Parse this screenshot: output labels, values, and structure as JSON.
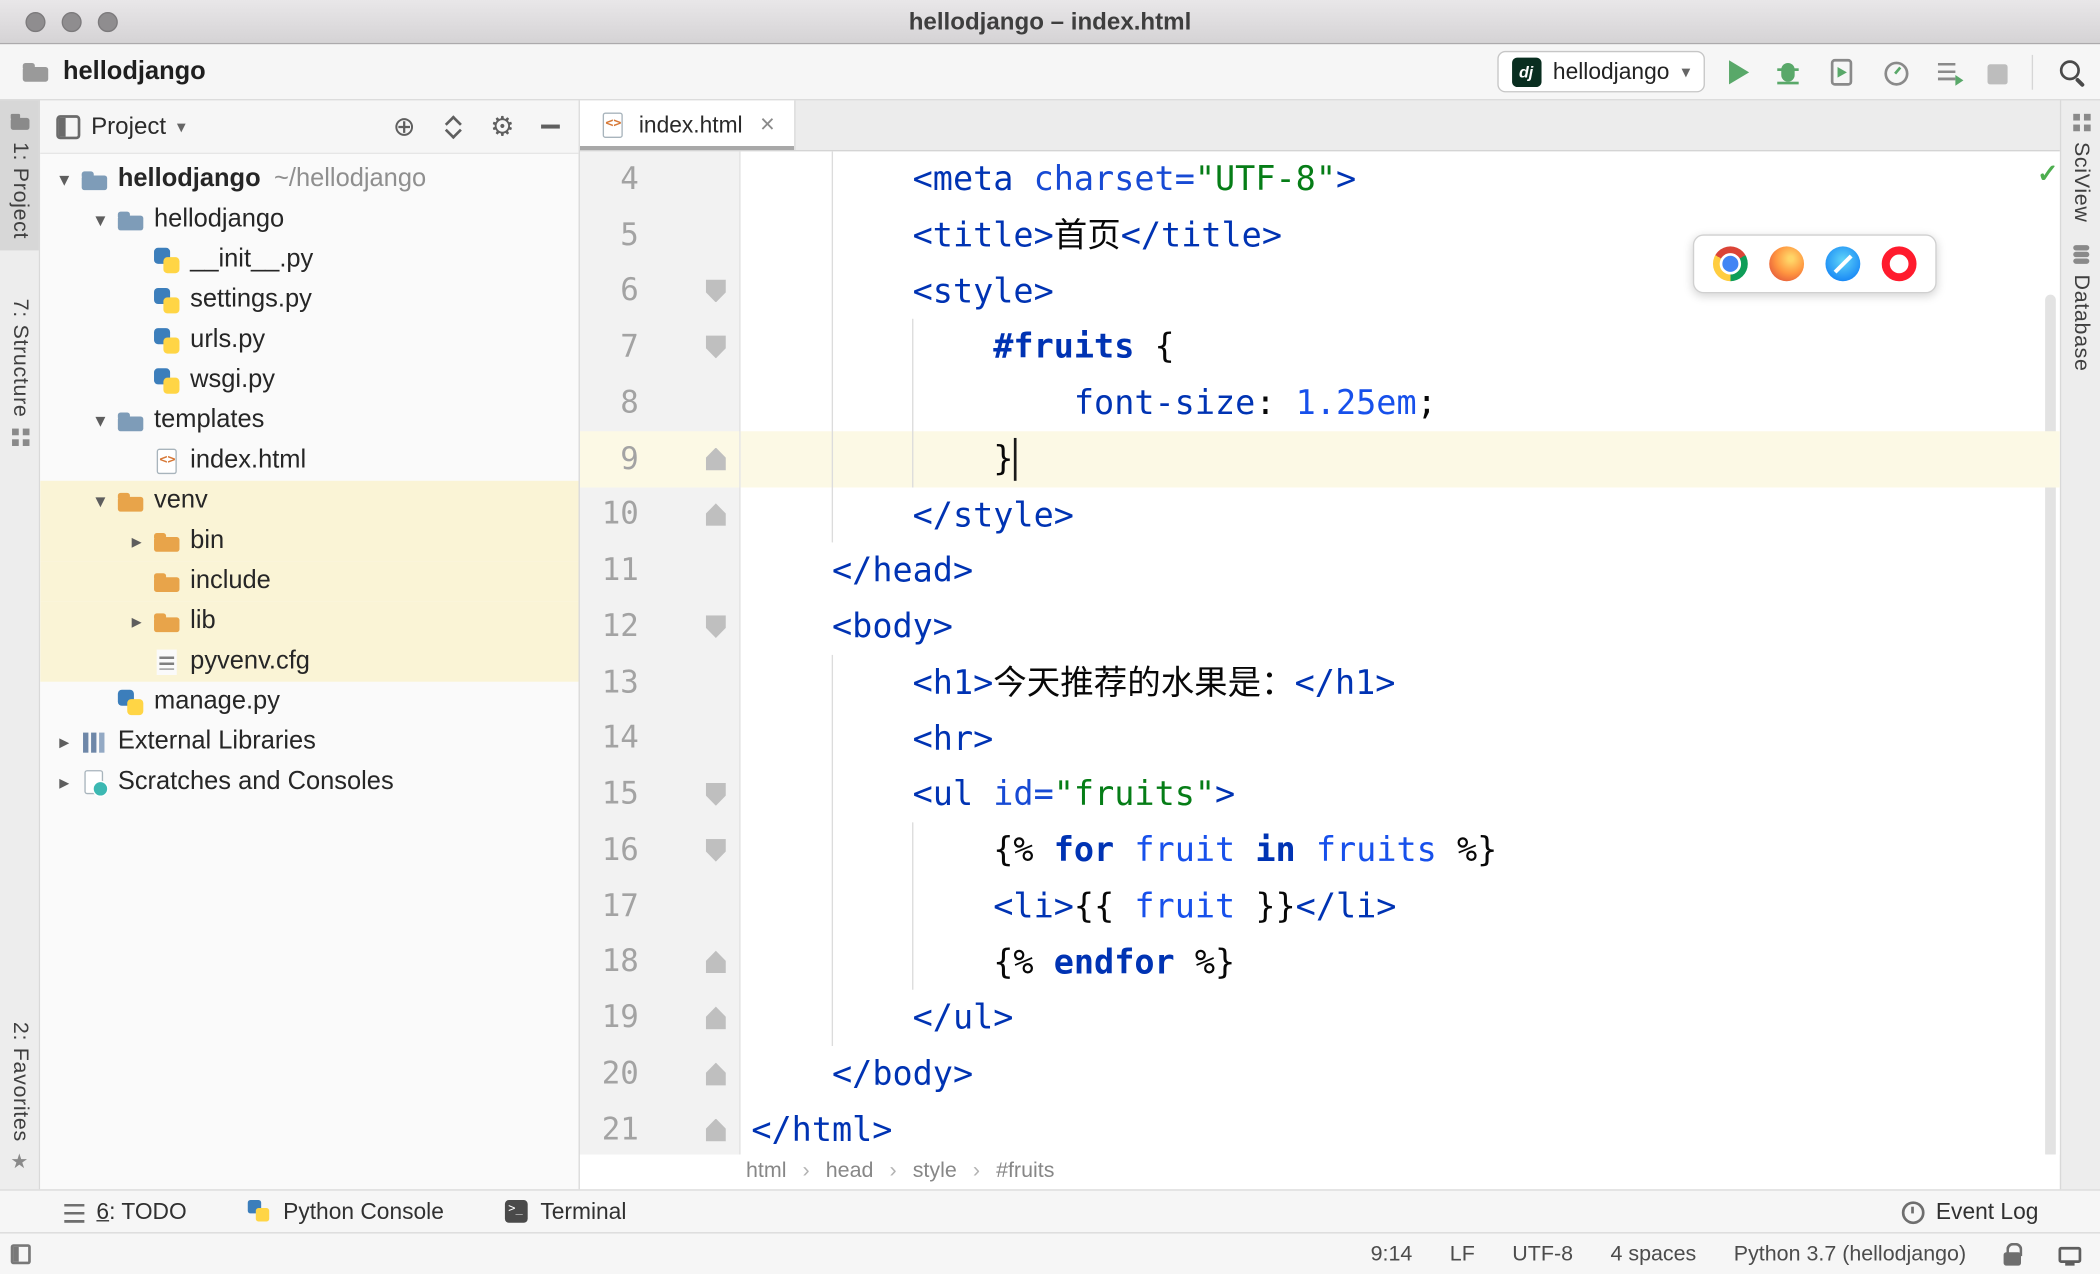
{
  "titlebar": {
    "title": "hellodjango – index.html"
  },
  "toolbar": {
    "project": "hellodjango",
    "run_config": "hellodjango",
    "dj_badge": "dj"
  },
  "docks": {
    "left": [
      "1: Project",
      "7: Structure"
    ],
    "left_bottom": [
      "2: Favorites"
    ],
    "right": [
      "SciView",
      "Database"
    ]
  },
  "project_panel": {
    "header": "Project",
    "tree": [
      {
        "label": "hellodjango",
        "suffix": "~/hellodjango",
        "level": 0,
        "icon": "folder-blue",
        "arrow": "down",
        "bold": true
      },
      {
        "label": "hellodjango",
        "level": 1,
        "icon": "folder-blue",
        "arrow": "down"
      },
      {
        "label": "__init__.py",
        "level": 2,
        "icon": "py"
      },
      {
        "label": "settings.py",
        "level": 2,
        "icon": "py"
      },
      {
        "label": "urls.py",
        "level": 2,
        "icon": "py"
      },
      {
        "label": "wsgi.py",
        "level": 2,
        "icon": "py"
      },
      {
        "label": "templates",
        "level": 1,
        "icon": "folder-blue",
        "arrow": "down"
      },
      {
        "label": "index.html",
        "level": 2,
        "icon": "html"
      },
      {
        "label": "venv",
        "level": 1,
        "icon": "folder-orange",
        "arrow": "down",
        "hl": true
      },
      {
        "label": "bin",
        "level": 2,
        "icon": "folder-orange",
        "arrow": "right",
        "hl": true
      },
      {
        "label": "include",
        "level": 2,
        "icon": "folder-orange",
        "hl": true
      },
      {
        "label": "lib",
        "level": 2,
        "icon": "folder-orange",
        "arrow": "right",
        "hl": true
      },
      {
        "label": "pyvenv.cfg",
        "level": 2,
        "icon": "cfg",
        "hl": true
      },
      {
        "label": "manage.py",
        "level": 1,
        "icon": "py"
      },
      {
        "label": "External Libraries",
        "level": 0,
        "icon": "lib",
        "arrow": "right"
      },
      {
        "label": "Scratches and Consoles",
        "level": 0,
        "icon": "scratch",
        "arrow": "right"
      }
    ]
  },
  "editor": {
    "tab": "index.html",
    "active_line": 9,
    "caret": {
      "line": 9,
      "col": 13
    },
    "breadcrumbs": [
      "html",
      "head",
      "style",
      "#fruits"
    ],
    "palette": {
      "tag": "#0033B3",
      "attr": "#174AD4",
      "str": "#067D17",
      "num": "#1750EB",
      "kw": "#0033B3",
      "var": "#1750EB",
      "plain": "#080808",
      "sel": "#0033B3",
      "prop": "#0033B3",
      "brace": "#080808"
    },
    "highlight_colors": {
      "active_line": "#FCF9E5",
      "tree_scope": "#FAF4D6"
    },
    "indent_guides": [
      {
        "col": 4,
        "from": 4,
        "to": 10
      },
      {
        "col": 8,
        "from": 7,
        "to": 9
      },
      {
        "col": 4,
        "from": 13,
        "to": 19
      },
      {
        "col": 8,
        "from": 16,
        "to": 18
      }
    ],
    "lines": [
      {
        "num": 4,
        "indent": 8,
        "tokens": [
          {
            "t": "<meta ",
            "c": "tag"
          },
          {
            "t": "charset",
            "c": "attr"
          },
          {
            "t": "=",
            "c": "attr"
          },
          {
            "t": "\"UTF-8\"",
            "c": "str"
          },
          {
            "t": ">",
            "c": "tag"
          }
        ]
      },
      {
        "num": 5,
        "indent": 8,
        "tokens": [
          {
            "t": "<title>",
            "c": "tag"
          },
          {
            "t": "首页",
            "c": "plain"
          },
          {
            "t": "</title>",
            "c": "tag"
          }
        ]
      },
      {
        "num": 6,
        "indent": 8,
        "fold": "start",
        "tokens": [
          {
            "t": "<style>",
            "c": "tag"
          }
        ]
      },
      {
        "num": 7,
        "indent": 12,
        "fold": "start",
        "tokens": [
          {
            "t": "#fruits",
            "c": "sel"
          },
          {
            "t": " {",
            "c": "plain"
          }
        ]
      },
      {
        "num": 8,
        "indent": 16,
        "tokens": [
          {
            "t": "font-size",
            "c": "prop"
          },
          {
            "t": ": ",
            "c": "plain"
          },
          {
            "t": "1.25em",
            "c": "num"
          },
          {
            "t": ";",
            "c": "plain"
          }
        ]
      },
      {
        "num": 9,
        "indent": 12,
        "fold": "end",
        "tokens": [
          {
            "t": "}",
            "c": "plain"
          }
        ]
      },
      {
        "num": 10,
        "indent": 8,
        "fold": "end",
        "tokens": [
          {
            "t": "</style>",
            "c": "tag"
          }
        ]
      },
      {
        "num": 11,
        "indent": 4,
        "tokens": [
          {
            "t": "</head>",
            "c": "tag"
          }
        ]
      },
      {
        "num": 12,
        "indent": 4,
        "fold": "start",
        "tokens": [
          {
            "t": "<body>",
            "c": "tag"
          }
        ]
      },
      {
        "num": 13,
        "indent": 8,
        "tokens": [
          {
            "t": "<h1>",
            "c": "tag"
          },
          {
            "t": "今天推荐的水果是：",
            "c": "plain"
          },
          {
            "t": "</h1>",
            "c": "tag"
          }
        ]
      },
      {
        "num": 14,
        "indent": 8,
        "tokens": [
          {
            "t": "<hr>",
            "c": "tag"
          }
        ]
      },
      {
        "num": 15,
        "indent": 8,
        "fold": "start",
        "tokens": [
          {
            "t": "<ul ",
            "c": "tag"
          },
          {
            "t": "id",
            "c": "attr"
          },
          {
            "t": "=",
            "c": "attr"
          },
          {
            "t": "\"fruits\"",
            "c": "str"
          },
          {
            "t": ">",
            "c": "tag"
          }
        ]
      },
      {
        "num": 16,
        "indent": 12,
        "fold": "start",
        "tokens": [
          {
            "t": "{% ",
            "c": "brace"
          },
          {
            "t": "for",
            "c": "kw"
          },
          {
            "t": " ",
            "c": "plain"
          },
          {
            "t": "fruit",
            "c": "var"
          },
          {
            "t": " ",
            "c": "plain"
          },
          {
            "t": "in",
            "c": "kw"
          },
          {
            "t": " ",
            "c": "plain"
          },
          {
            "t": "fruits",
            "c": "var"
          },
          {
            "t": " %}",
            "c": "brace"
          }
        ]
      },
      {
        "num": 17,
        "indent": 12,
        "tokens": [
          {
            "t": "<li>",
            "c": "tag"
          },
          {
            "t": "{{ ",
            "c": "brace"
          },
          {
            "t": "fruit",
            "c": "var"
          },
          {
            "t": " }}",
            "c": "brace"
          },
          {
            "t": "</li>",
            "c": "tag"
          }
        ]
      },
      {
        "num": 18,
        "indent": 12,
        "fold": "end",
        "tokens": [
          {
            "t": "{% ",
            "c": "brace"
          },
          {
            "t": "endfor",
            "c": "kw"
          },
          {
            "t": " %}",
            "c": "brace"
          }
        ]
      },
      {
        "num": 19,
        "indent": 8,
        "fold": "end",
        "tokens": [
          {
            "t": "</ul>",
            "c": "tag"
          }
        ]
      },
      {
        "num": 20,
        "indent": 4,
        "fold": "end",
        "tokens": [
          {
            "t": "</body>",
            "c": "tag"
          }
        ]
      },
      {
        "num": 21,
        "indent": 0,
        "fold": "end",
        "tokens": [
          {
            "t": "</html>",
            "c": "tag"
          }
        ]
      }
    ]
  },
  "bottom_bar": {
    "todo_mnemonic": "6",
    "todo_rest": ": TODO",
    "python_console": "Python Console",
    "terminal": "Terminal",
    "event_log": "Event Log"
  },
  "status_bar": {
    "items": [
      "9:14",
      "LF",
      "UTF-8",
      "4 spaces",
      "Python 3.7 (hellodjango)"
    ]
  }
}
